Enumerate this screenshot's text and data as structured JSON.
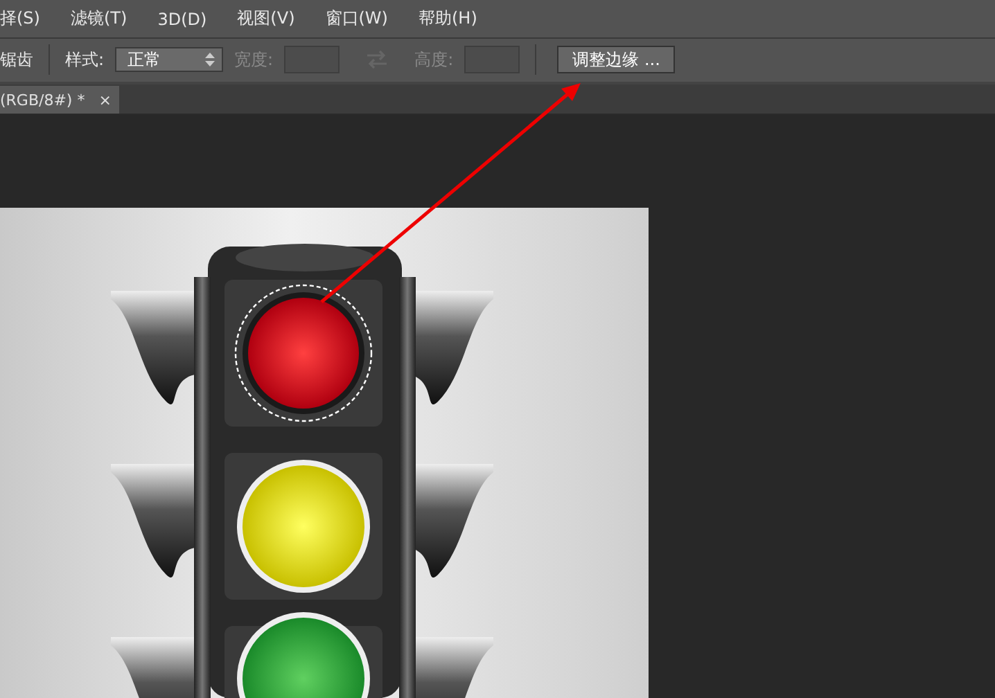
{
  "menu": [
    "择(S)",
    "滤镜(T)",
    "3D(D)",
    "视图(V)",
    "窗口(W)",
    "帮助(H)"
  ],
  "options": {
    "antialias_label": "锯齿",
    "style_label": "样式:",
    "style_value": "正常",
    "fields": [
      {
        "label": "宽度:",
        "disabled": true
      },
      {
        "label": "高度:",
        "disabled": true
      }
    ],
    "refine_button": "调整边缘 ..."
  },
  "document_tab": {
    "title": "(RGB/8#) *",
    "close": "×",
    "selected": true
  }
}
